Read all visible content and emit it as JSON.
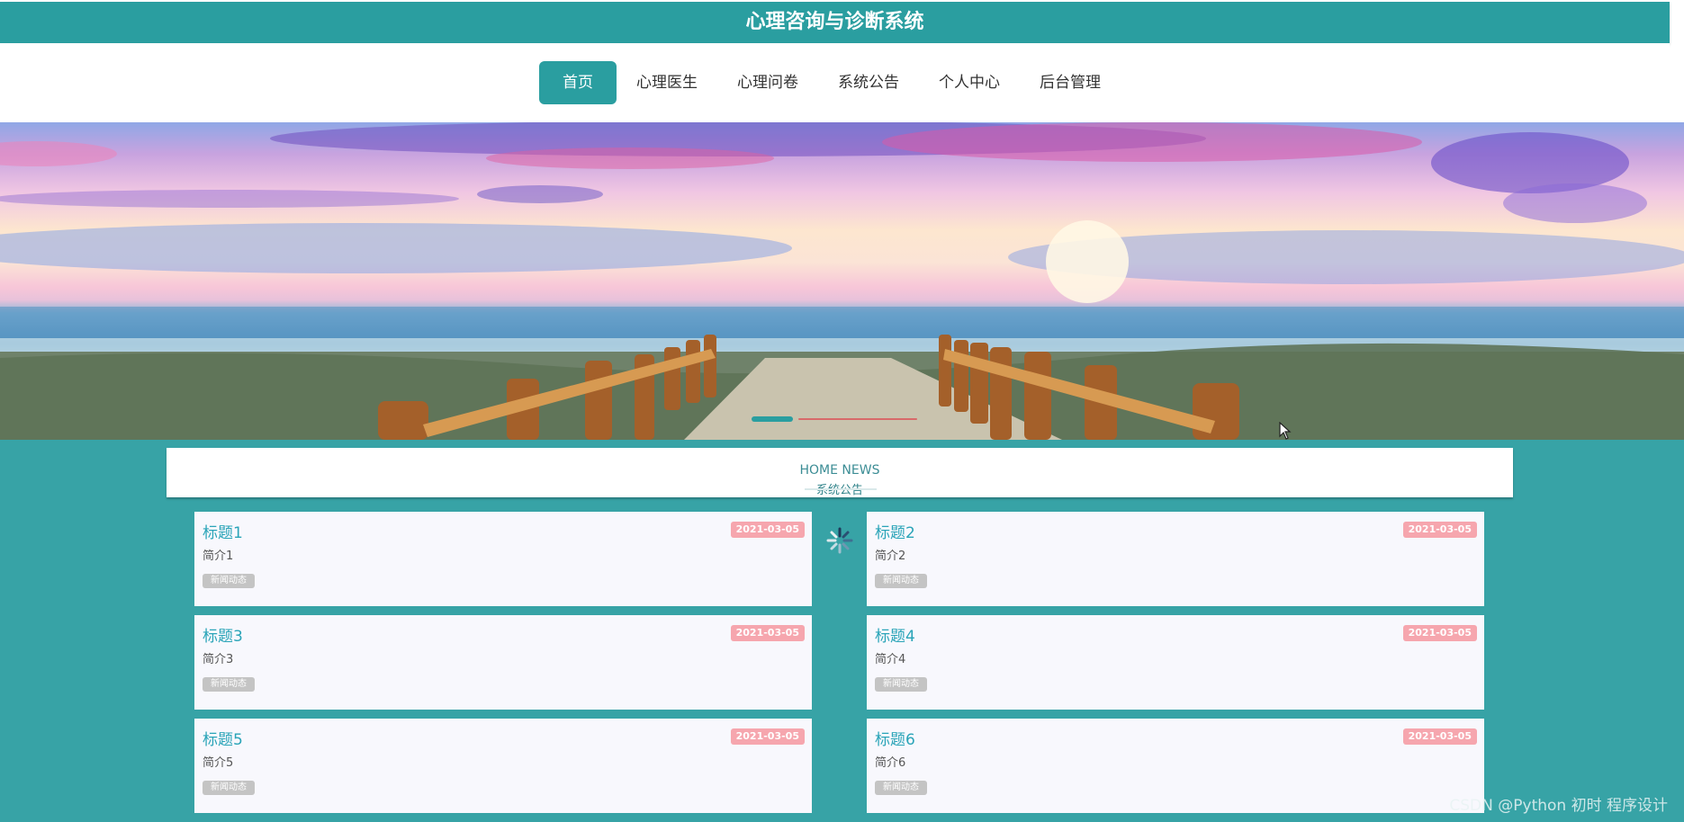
{
  "header": {
    "title": "心理咨询与诊断系统"
  },
  "nav": {
    "items": [
      {
        "label": "首页"
      },
      {
        "label": "心理医生"
      },
      {
        "label": "心理问卷"
      },
      {
        "label": "系统公告"
      },
      {
        "label": "个人中心"
      },
      {
        "label": "后台管理"
      }
    ],
    "active_index": 0
  },
  "banner": {
    "image": "sunset-beach-boardwalk",
    "carousel": {
      "slides": 2,
      "active": 0
    }
  },
  "news": {
    "title_en": "HOME NEWS",
    "title_cn": "系统公告",
    "items": [
      {
        "title": "标题1",
        "date": "2021-03-05",
        "intro": "简介1",
        "tag": "新闻动态"
      },
      {
        "title": "标题2",
        "date": "2021-03-05",
        "intro": "简介2",
        "tag": "新闻动态"
      },
      {
        "title": "标题3",
        "date": "2021-03-05",
        "intro": "简介3",
        "tag": "新闻动态"
      },
      {
        "title": "标题4",
        "date": "2021-03-05",
        "intro": "简介4",
        "tag": "新闻动态"
      },
      {
        "title": "标题5",
        "date": "2021-03-05",
        "intro": "简介5",
        "tag": "新闻动态"
      },
      {
        "title": "标题6",
        "date": "2021-03-05",
        "intro": "简介6",
        "tag": "新闻动态"
      }
    ]
  },
  "icons": {
    "loading": "loading-spinner-icon",
    "cursor": "mouse-cursor-icon"
  },
  "colors": {
    "primary": "#2a9ea0",
    "content_bg": "#37a3a6",
    "date_badge": "#f6a6ae",
    "card_title": "#2aa4b8"
  },
  "watermark": "CSDN @Python 初时 程序设计"
}
